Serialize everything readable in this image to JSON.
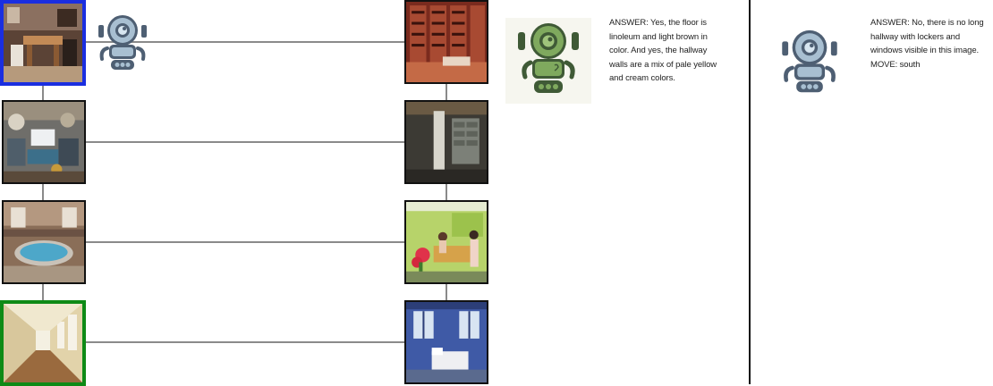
{
  "graph": {
    "left_column": [
      {
        "id": "office",
        "label": "office-room",
        "state": "selected"
      },
      {
        "id": "trophy",
        "label": "trophy-room",
        "state": "normal"
      },
      {
        "id": "hot_tub",
        "label": "hot-tub-room",
        "state": "normal"
      },
      {
        "id": "hallway",
        "label": "hallway",
        "state": "target"
      }
    ],
    "right_column": [
      {
        "id": "wine_cellar",
        "label": "wine-cellar"
      },
      {
        "id": "basement",
        "label": "basement"
      },
      {
        "id": "lobby",
        "label": "lobby"
      },
      {
        "id": "bedroom",
        "label": "bedroom"
      }
    ],
    "edges": [
      [
        "office",
        "wine_cellar"
      ],
      [
        "trophy",
        "basement"
      ],
      [
        "hot_tub",
        "lobby"
      ],
      [
        "hallway",
        "bedroom"
      ],
      [
        "office",
        "trophy"
      ],
      [
        "trophy",
        "hot_tub"
      ],
      [
        "hot_tub",
        "hallway"
      ],
      [
        "wine_cellar",
        "basement"
      ],
      [
        "basement",
        "lobby"
      ],
      [
        "lobby",
        "bedroom"
      ]
    ]
  },
  "panel_green": {
    "robot_icon": "green-robot-icon",
    "lines": [
      "ANSWER: Yes, the floor is",
      "linoleum and light brown in",
      "color. And yes, the hallway",
      "walls are a mix of pale yellow",
      "and cream colors."
    ]
  },
  "panel_blue": {
    "robot_icon": "blue-robot-icon",
    "lines": [
      "ANSWER: No, there is no long",
      "hallway with lockers and",
      "windows visible in this image.",
      "MOVE: south"
    ]
  },
  "colors": {
    "selected": "#1a2ee0",
    "target": "#0e8a16",
    "edge": "#8a8a8a"
  }
}
